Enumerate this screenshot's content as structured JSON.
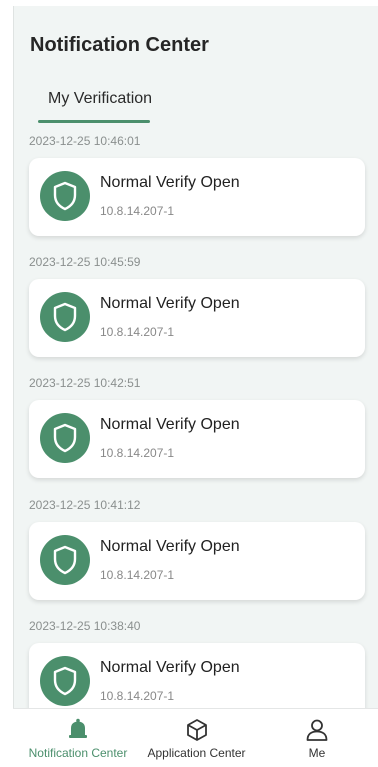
{
  "header": {
    "title": "Notification Center"
  },
  "tabs": [
    {
      "label": "My Verification",
      "active": true
    }
  ],
  "notifications": [
    {
      "time": "2023-12-25 10:46:01",
      "title": "Normal Verify Open",
      "subtitle": "10.8.14.207-1",
      "icon": "shield-icon"
    },
    {
      "time": "2023-12-25 10:45:59",
      "title": "Normal Verify Open",
      "subtitle": "10.8.14.207-1",
      "icon": "shield-icon"
    },
    {
      "time": "2023-12-25 10:42:51",
      "title": "Normal Verify Open",
      "subtitle": "10.8.14.207-1",
      "icon": "shield-icon"
    },
    {
      "time": "2023-12-25 10:41:12",
      "title": "Normal Verify Open",
      "subtitle": "10.8.14.207-1",
      "icon": "shield-icon"
    },
    {
      "time": "2023-12-25 10:38:40",
      "title": "Normal Verify Open",
      "subtitle": "10.8.14.207-1",
      "icon": "shield-icon"
    }
  ],
  "bottom_nav": [
    {
      "label": "Notification Center",
      "icon": "bell-icon",
      "active": true
    },
    {
      "label": "Application Center",
      "icon": "cube-icon",
      "active": false
    },
    {
      "label": "Me",
      "icon": "person-icon",
      "active": false
    }
  ],
  "colors": {
    "accent": "#4b8f6c",
    "background": "#f1f5f4",
    "card": "#ffffff"
  }
}
